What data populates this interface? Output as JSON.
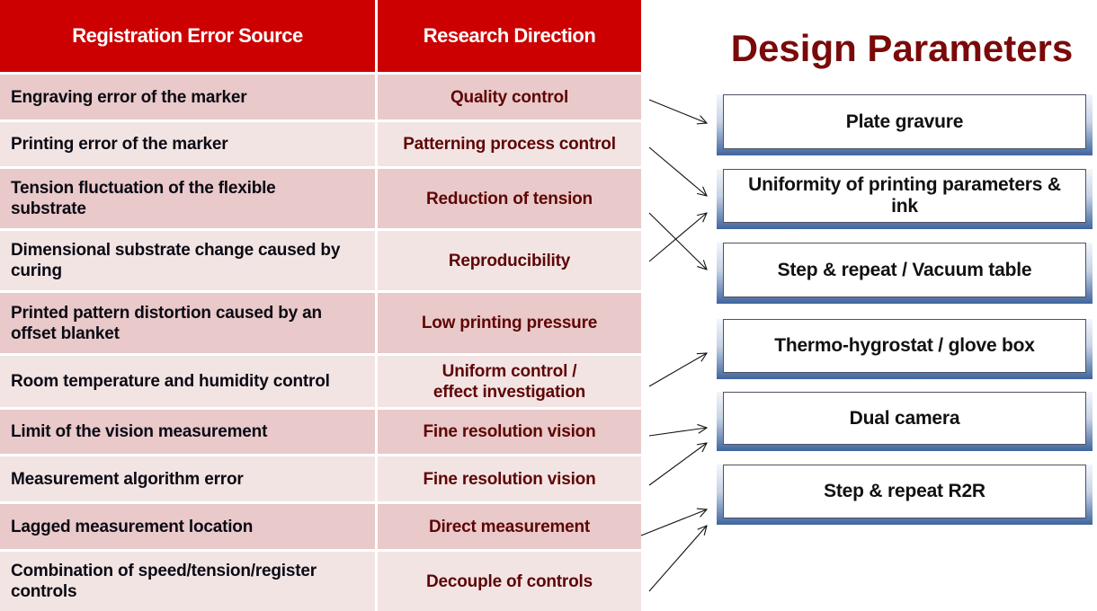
{
  "table": {
    "headers": {
      "source": "Registration Error Source",
      "direction": "Research Direction"
    },
    "rows": [
      {
        "source": "Engraving error of the marker",
        "direction": "Quality control"
      },
      {
        "source": "Printing error of the marker",
        "direction": "Patterning process control"
      },
      {
        "source": "Tension fluctuation of the flexible substrate",
        "direction": "Reduction of tension"
      },
      {
        "source": "Dimensional substrate change caused by curing",
        "direction": "Reproducibility"
      },
      {
        "source": "Printed pattern distortion caused by an offset blanket",
        "direction": "Low printing pressure"
      },
      {
        "source": "Room temperature and humidity control",
        "direction": "Uniform control / effect investigation"
      },
      {
        "source": "Limit of the vision measurement",
        "direction": "Fine resolution vision"
      },
      {
        "source": "Measurement algorithm error",
        "direction": "Fine resolution vision"
      },
      {
        "source": "Lagged measurement location",
        "direction": "Direct measurement"
      },
      {
        "source": "Combination of speed/tension/register controls",
        "direction": "Decouple of controls"
      }
    ]
  },
  "design": {
    "title": "Design Parameters",
    "parameters": [
      {
        "label": "Plate gravure"
      },
      {
        "label": "Uniformity of printing parameters & ink"
      },
      {
        "label": "Step & repeat / Vacuum table"
      },
      {
        "label": "Thermo-hygrostat / glove box"
      },
      {
        "label": "Dual camera"
      },
      {
        "label": "Step & repeat R2R"
      }
    ]
  },
  "connections": [
    {
      "from_row": 1,
      "to_parameter": 1
    },
    {
      "from_row": 2,
      "to_parameter": 2
    },
    {
      "from_row": 3,
      "to_parameter": 3
    },
    {
      "from_row": 4,
      "to_parameter": 2
    },
    {
      "from_row": 6,
      "to_parameter": 4
    },
    {
      "from_row": 7,
      "to_parameter": 5
    },
    {
      "from_row": 8,
      "to_parameter": 5
    },
    {
      "from_row": 9,
      "to_parameter": 6
    },
    {
      "from_row": 10,
      "to_parameter": 6
    }
  ],
  "colors": {
    "header_bg": "#cc0000",
    "row_dark": "#e9c9c9",
    "row_light": "#f3e4e4",
    "direction_text": "#5e0505",
    "title_text": "#7a0a0a",
    "box_accent": "#3f659e"
  }
}
